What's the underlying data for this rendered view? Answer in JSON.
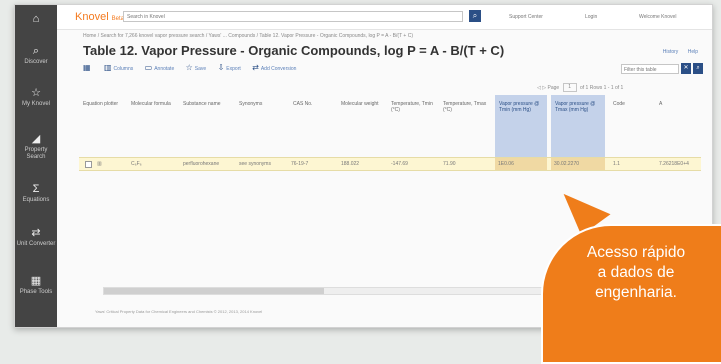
{
  "app": {
    "logo": "Knovel",
    "logo_badge": "Beta",
    "search_placeholder": "Search in Knovel",
    "search_icon": "search-icon",
    "links": [
      "Support Center",
      "Login",
      "Welcome Knovel"
    ]
  },
  "sidebar": {
    "items": [
      {
        "icon": "home-icon",
        "label": ""
      },
      {
        "icon": "search-icon",
        "label": "Discover"
      },
      {
        "icon": "star-icon",
        "label": "My Knovel"
      },
      {
        "icon": "chart-icon",
        "label": "Property Search"
      },
      {
        "icon": "sigma-icon",
        "label": "Equations"
      },
      {
        "icon": "convert-icon",
        "label": "Unit Converter"
      },
      {
        "icon": "table-icon",
        "label": "Phase Tools"
      }
    ]
  },
  "breadcrumb": "Home / Search for 7,266 knovel vapor pressure search / Yaws' ... Compounds / Table 12. Vapor Pressure - Organic Compounds, log P = A - B/(T + C)",
  "page": {
    "title": "Table 12. Vapor Pressure - Organic Compounds, log P = A - B/(T + C)",
    "actions": [
      "History",
      "Help"
    ]
  },
  "toolbar": {
    "items": [
      {
        "icon": "grid-icon",
        "label": ""
      },
      {
        "icon": "columns-icon",
        "label": "Columns"
      },
      {
        "icon": "comment-icon",
        "label": "Annotate"
      },
      {
        "icon": "star-icon",
        "label": "Save"
      },
      {
        "icon": "export-icon",
        "label": "Export"
      },
      {
        "icon": "convert-icon",
        "label": "Add Conversion"
      }
    ],
    "filter_value": "Filter this table"
  },
  "pager": {
    "label": "Page",
    "current": "1",
    "of": "of 1",
    "rows": "Rows 1 - 1 of 1"
  },
  "table": {
    "columns": [
      "Equation plotter",
      "Molecular formula",
      "Substance name",
      "Synonyms",
      "CAS No.",
      "Molecular weight",
      "Temperature, Tmin (°C)",
      "Temperature, Tmax (°C)",
      "Vapor pressure @ Tmin (mm Hg)",
      "Vapor pressure @ Tmax (mm Hg)",
      "Code",
      "A"
    ],
    "highlight_columns": [
      8,
      9
    ],
    "rows": [
      [
        "",
        "C₆F₆",
        "perfluorohexane",
        "see synonyms",
        "76-19-7",
        "188.022",
        "-147.69",
        "71.90",
        "1E0.06",
        "30.02.2270",
        "1.1",
        "7.26218E0+4"
      ]
    ]
  },
  "footer": "Yaws' Critical Property Data for Chemical Engineers and Chemists © 2012, 2013, 2014 Knovel",
  "callout": {
    "lines": [
      "Acesso rápido",
      "a dados de",
      "engenharia."
    ],
    "color": "#ef7d1a"
  },
  "colors": {
    "brand": "#f47b20",
    "nav_dark": "#444444",
    "accent_blue": "#2b4f86",
    "highlight_col": "#c4d2ea",
    "row_highlight": "#fdf6d2"
  }
}
